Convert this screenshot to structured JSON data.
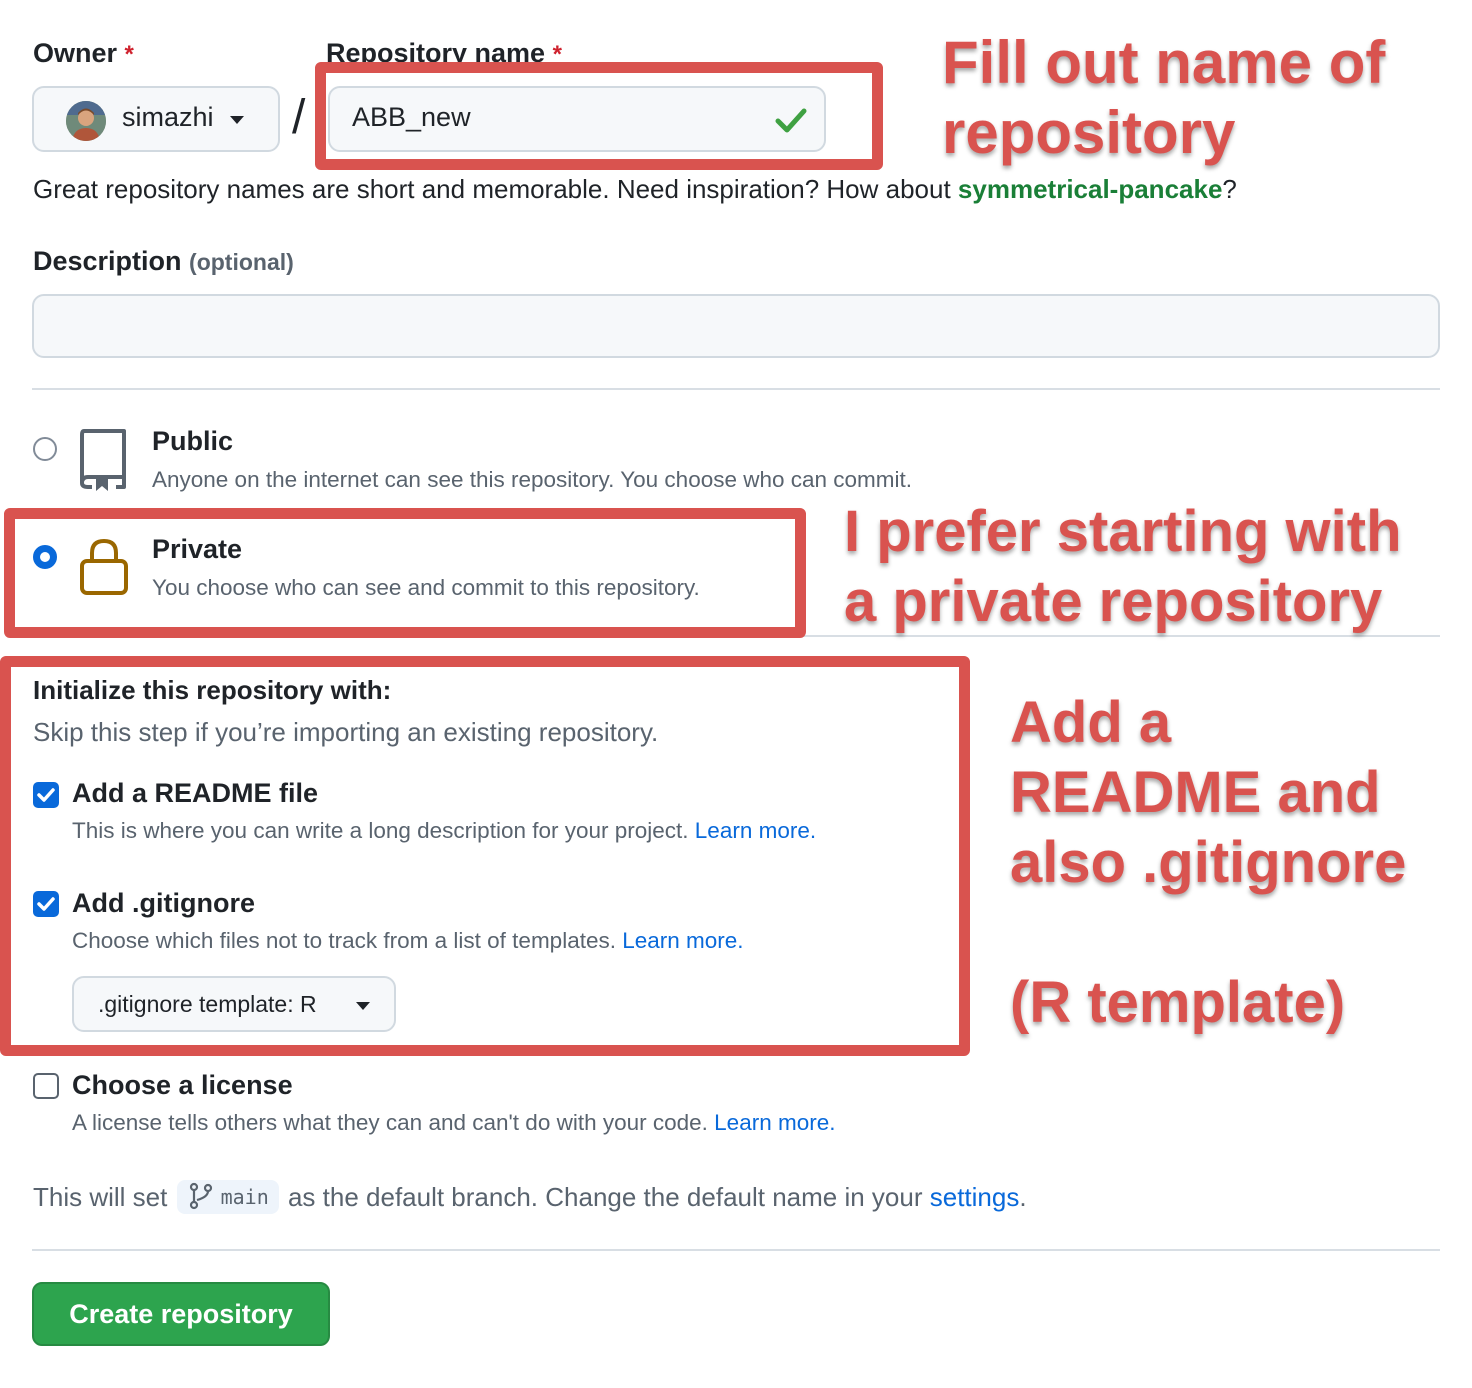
{
  "owner": {
    "label": "Owner",
    "required": "*",
    "name": "simazhi"
  },
  "separator": "/",
  "repo": {
    "label": "Repository name",
    "required": "*",
    "value": "ABB_new"
  },
  "hint": {
    "text": "Great repository names are short and memorable. Need inspiration? How about ",
    "suggestion": "symmetrical-pancake",
    "end": "?"
  },
  "description": {
    "label": "Description",
    "optional": "(optional)",
    "value": ""
  },
  "visibility": {
    "public": {
      "title": "Public",
      "desc": "Anyone on the internet can see this repository. You choose who can commit.",
      "selected": false
    },
    "private": {
      "title": "Private",
      "desc": "You choose who can see and commit to this repository.",
      "selected": true
    }
  },
  "init": {
    "title": "Initialize this repository with:",
    "subtitle": "Skip this step if you’re importing an existing repository.",
    "readme": {
      "title": "Add a README file",
      "desc": "This is where you can write a long description for your project. ",
      "link": "Learn more.",
      "checked": true
    },
    "gitignore": {
      "title": "Add .gitignore",
      "desc": "Choose which files not to track from a list of templates. ",
      "link": "Learn more.",
      "checked": true,
      "template_label": ".gitignore template: R"
    },
    "license": {
      "title": "Choose a license",
      "desc": "A license tells others what they can and can't do with your code. ",
      "link": "Learn more.",
      "checked": false
    }
  },
  "branch": {
    "before": "This will set ",
    "name": "main",
    "after": " as the default branch. Change the default name in your ",
    "link": "settings",
    "end": "."
  },
  "create_label": "Create repository",
  "annotations": {
    "name": "Fill out name of\nrepository",
    "private": "I prefer starting with\na private repository",
    "init": "Add a\nREADME and\nalso .gitignore\n\n(R template)"
  },
  "colors": {
    "accent": "#0969da",
    "annotation": "#d9534f",
    "create": "#2da44e",
    "check_green": "#3fa142"
  }
}
